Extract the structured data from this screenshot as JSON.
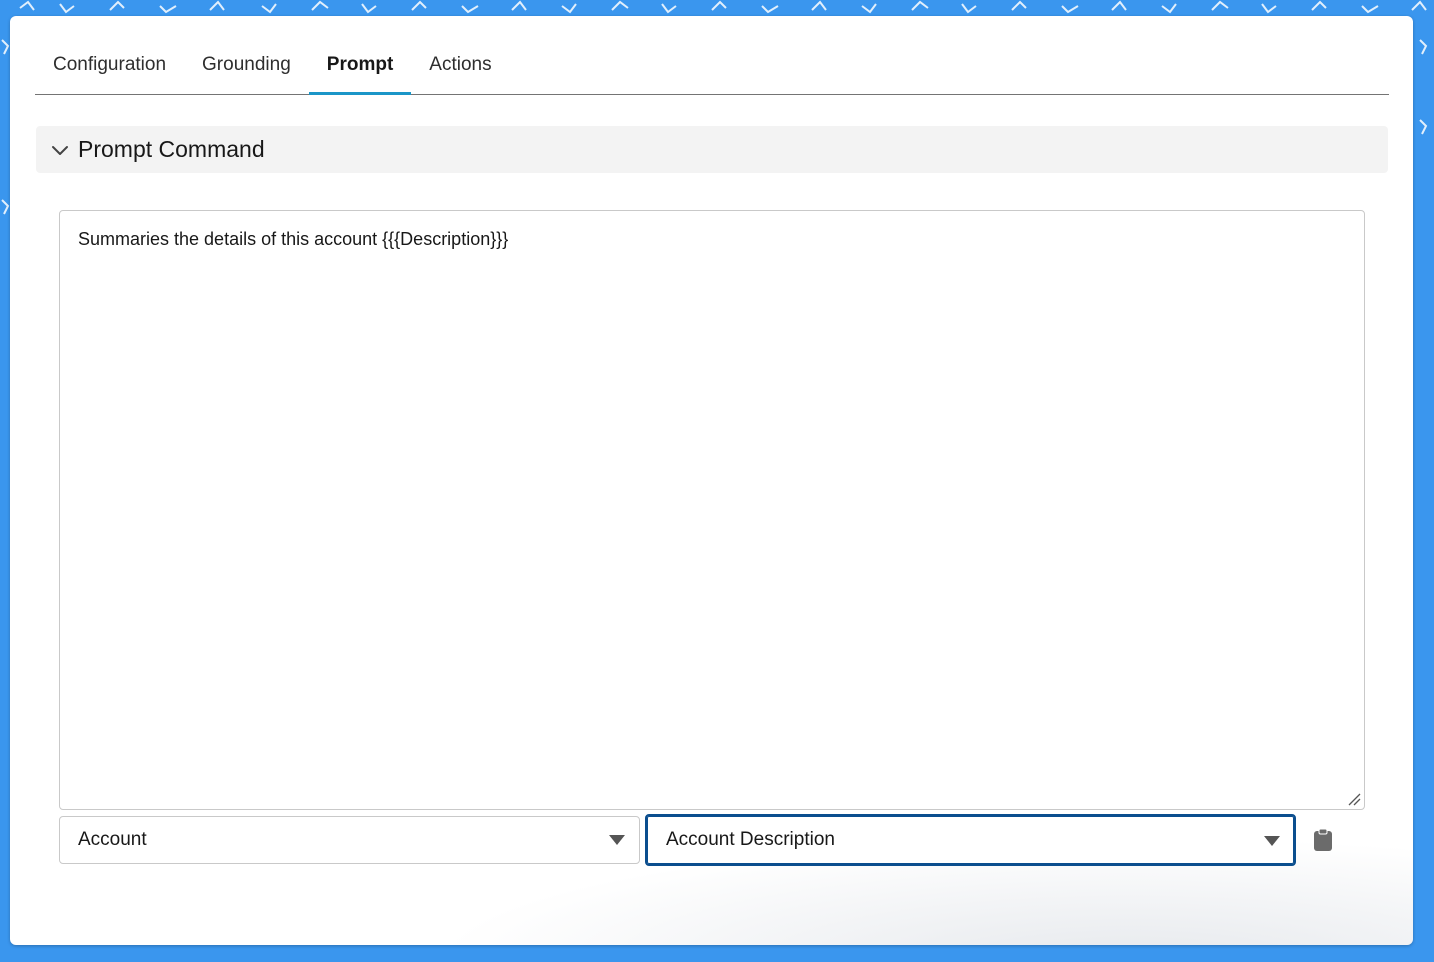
{
  "tabs": [
    {
      "label": "Configuration",
      "active": false
    },
    {
      "label": "Grounding",
      "active": false
    },
    {
      "label": "Prompt",
      "active": true
    },
    {
      "label": "Actions",
      "active": false
    }
  ],
  "section": {
    "title": "Prompt Command",
    "expanded": true,
    "icon": "chevron-down-icon"
  },
  "prompt": {
    "text": "Summaries the details of this account {{{Description}}}"
  },
  "object_select": {
    "value": "Account",
    "icon": "caret-down-icon"
  },
  "field_select": {
    "value": "Account Description",
    "icon": "caret-down-icon",
    "focused": true
  },
  "insert_button": {
    "icon": "clipboard-icon"
  },
  "colors": {
    "background": "#3a96ee",
    "accent": "#1b96c8",
    "focus_border": "#0b4e8e",
    "section_bg": "#f3f3f3"
  }
}
